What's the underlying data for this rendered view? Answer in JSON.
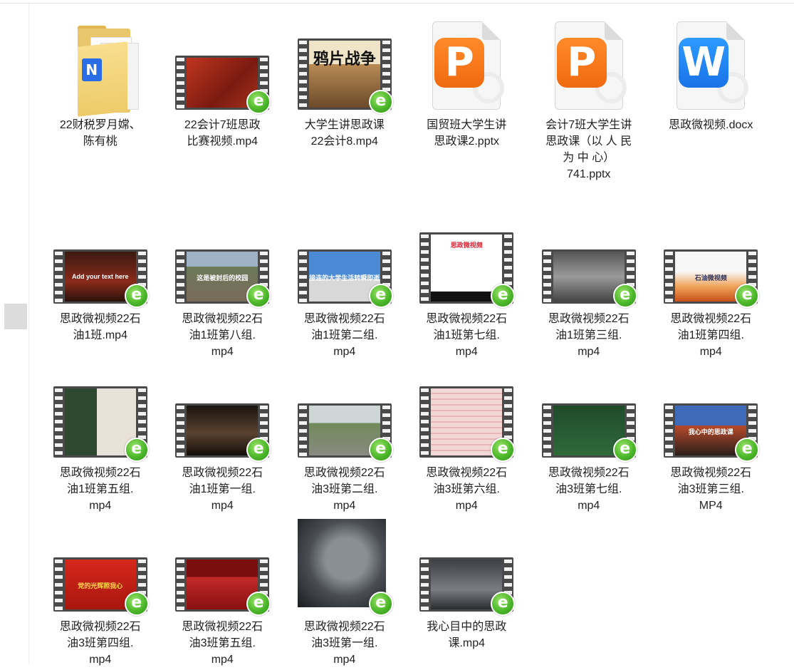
{
  "items": [
    {
      "name": "22财税罗月嫦、\n陈有桃",
      "kind": "folder"
    },
    {
      "name": "22会计7班思政\n比赛视频.mp4",
      "kind": "video",
      "thumb": {
        "bg": "linear-gradient(135deg,#c0351f,#7a1a10 60%,#a8321c)",
        "ratio": "wide"
      }
    },
    {
      "name": "大学生讲思政课\n22会计8.mp4",
      "kind": "video",
      "thumb": {
        "bg": "linear-gradient(180deg,#efe3c8 0 35%,#b98b55 35%,#6b4a2a)",
        "ratio": "tall",
        "caption": "鸦片战争",
        "capcolor": "#111"
      }
    },
    {
      "name": "国贸班大学生讲\n思政课2.pptx",
      "kind": "ppt",
      "mark": "P"
    },
    {
      "name": "会计7班大学生讲\n思政课（以 人 民\n为 中 心）\n741.pptx",
      "kind": "ppt",
      "mark": "P"
    },
    {
      "name": "思政微视频.docx",
      "kind": "docx",
      "mark": "W"
    },
    {
      "name": "思政微视频22石\n油1班.mp4",
      "kind": "video",
      "thumb": {
        "bg": "linear-gradient(180deg,#3a1a12,#8a2a1a 60%,#2a120c)",
        "ratio": "wide",
        "caption": "Add your text here",
        "capcolor": "#fff"
      }
    },
    {
      "name": "思政微视频22石\n油1班第八组.\nmp4",
      "kind": "video",
      "thumb": {
        "bg": "linear-gradient(180deg,#9fb3c6 0 30%,#6b7a5a 30%,#7a6a5a)",
        "ratio": "wide",
        "caption": "这是被封后的校园",
        "capcolor": "#fff"
      }
    },
    {
      "name": "思政微视频22石\n油1班第二组.\nmp4",
      "kind": "video",
      "thumb": {
        "bg": "linear-gradient(180deg,#4d8ad6 0 55%,#d8d8d8 55%)",
        "ratio": "wide",
        "caption": "接连的大学生活转瞬即逝",
        "capcolor": "#fff"
      }
    },
    {
      "name": "思政微视频22石\n油1班第七组.\nmp4",
      "kind": "video",
      "thumb": {
        "bg": "linear-gradient(180deg,#ffffff 0 85%,#111 85%)",
        "ratio": "tall",
        "caption": "思政微视频",
        "capcolor": "#d23"
      }
    },
    {
      "name": "思政微视频22石\n油1班第三组.\nmp4",
      "kind": "video",
      "thumb": {
        "bg": "linear-gradient(180deg,#555,#9a9a9a 50%,#444)",
        "ratio": "wide"
      }
    },
    {
      "name": "思政微视频22石\n油1班第四组.\nmp4",
      "kind": "video",
      "thumb": {
        "bg": "linear-gradient(180deg,#f7f7f7 0 40%,#f0a35a 70%,#c8501a)",
        "ratio": "wide",
        "caption": "石油微视频",
        "capcolor": "#335"
      }
    },
    {
      "name": "思政微视频22石\n油1班第五组.\nmp4",
      "kind": "video",
      "thumb": {
        "bg": "linear-gradient(90deg,#2d4a30 0 45%,#e8e2d8 45%)",
        "ratio": "tall"
      }
    },
    {
      "name": "思政微视频22石\n油1班第一组.\nmp4",
      "kind": "video",
      "thumb": {
        "bg": "linear-gradient(180deg,#1a1410,#5a4230 55%,#140e0a)",
        "ratio": "wide"
      }
    },
    {
      "name": "思政微视频22石\n油3班第二组.\nmp4",
      "kind": "video",
      "thumb": {
        "bg": "linear-gradient(180deg,#cfd6d6 0 35%,#6f8a5a 35%,#8a8a80)",
        "ratio": "wide"
      }
    },
    {
      "name": "思政微视频22石\n油3班第六组.\nmp4",
      "kind": "video",
      "thumb": {
        "bg": "repeating-linear-gradient(180deg,#f3d6d6 0 6px,#e9b6b6 6px 8px)",
        "ratio": "tall"
      }
    },
    {
      "name": "思政微视频22石\n油3班第七组.\nmp4",
      "kind": "video",
      "thumb": {
        "bg": "linear-gradient(180deg,#1f4a2a,#2f6a3a)",
        "ratio": "wide"
      }
    },
    {
      "name": "思政微视频22石\n油3班第三组.\nMP4",
      "kind": "video",
      "thumb": {
        "bg": "linear-gradient(180deg,#3f6ab8 0 40%,#b84a2a 40%,#2a1e1a)",
        "ratio": "wide",
        "caption": "我心中的思政课",
        "capcolor": "#fff"
      }
    },
    {
      "name": "思政微视频22石\n油3班第四组.\nmp4",
      "kind": "video",
      "thumb": {
        "bg": "linear-gradient(180deg,#d6281c,#a8160e)",
        "ratio": "wide",
        "caption": "党的光辉照我心",
        "capcolor": "#ffd94a"
      }
    },
    {
      "name": "思政微视频22石\n油3班第五组.\nmp4",
      "kind": "video",
      "thumb": {
        "bg": "linear-gradient(180deg,#7a0e0e 0 35%,#c22a2a 35%,#8a1010)",
        "ratio": "wide"
      }
    },
    {
      "name": "思政微视频22石\n油3班第一组.\nmp4",
      "kind": "photo",
      "thumb": {
        "bg": "radial-gradient(circle at 55% 45%,#8a8f96 0 30%,#4a4e54 55%,#1a1c1e)"
      }
    },
    {
      "name": "我心目中的思政\n课.mp4",
      "kind": "video",
      "thumb": {
        "bg": "linear-gradient(180deg,#3c3f44,#7a7d82 60%,#2a2c30)",
        "ratio": "wide"
      }
    }
  ],
  "icons": {
    "edit_badge": "e",
    "video_badge_color": "#4cb82a"
  }
}
